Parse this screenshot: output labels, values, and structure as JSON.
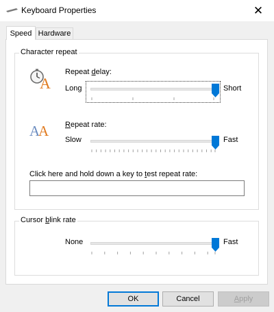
{
  "window": {
    "title": "Keyboard Properties",
    "close_symbol": "✕"
  },
  "tabs": [
    {
      "label": "Speed",
      "active": true
    },
    {
      "label": "Hardware",
      "active": false
    }
  ],
  "character_repeat": {
    "group_label": "Character repeat",
    "repeat_delay": {
      "label_pre": "Repeat ",
      "label_access": "d",
      "label_post": "elay:",
      "min_label": "Long",
      "max_label": "Short",
      "level": 1.0
    },
    "repeat_rate": {
      "label_pre": "",
      "label_access": "R",
      "label_post": "epeat rate:",
      "min_label": "Slow",
      "max_label": "Fast",
      "level": 1.0
    },
    "test_prompt_pre": "Click here and hold down a key to ",
    "test_prompt_access": "t",
    "test_prompt_post": "est repeat rate:",
    "test_value": ""
  },
  "cursor_blink": {
    "group_label_pre": "Cursor ",
    "group_label_access": "b",
    "group_label_post": "link rate",
    "min_label": "None",
    "max_label": "Fast",
    "level": 1.0
  },
  "buttons": {
    "ok": "OK",
    "cancel": "Cancel",
    "apply_pre": "",
    "apply_access": "A",
    "apply_post": "pply"
  },
  "colors": {
    "accent": "#0078d7",
    "icon_letter": "#e07a1f"
  }
}
